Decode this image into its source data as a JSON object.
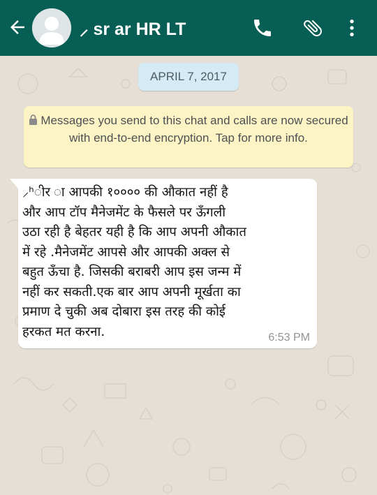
{
  "header": {
    "title": "⸝ sr ar HR LT",
    "icons": [
      "back-arrow-icon",
      "avatar-icon",
      "phone-icon",
      "paperclip-icon",
      "more-vert-icon"
    ],
    "bar_color": "#075e54"
  },
  "chat": {
    "date_chip": "APRIL 7, 2017",
    "encryption_notice": "Messages you send to this chat and calls are now secured with end-to-end encryption. Tap for more info.",
    "message": {
      "text": "⸝ʰीर ा आपकी १०००० की औकात नहीं है\nऔर आप टॉप मैनेजमेंट के फैसले पर ऊँगली\nउठा रही है बेहतर यही है कि आप अपनी औकात\nमें रहे .मैनेजमेंट  आपसे और आपकी अक्ल से\nबहुत ऊँचा है. जिसकी बराबरी आप इस जन्म में\nनहीं कर सकती.एक बार आप अपनी मूर्खता का\nप्रमाण दे चुकी अब दोबारा इस तरह की कोई\nहरकत मत करना.",
      "time": "6:53 PM"
    }
  }
}
